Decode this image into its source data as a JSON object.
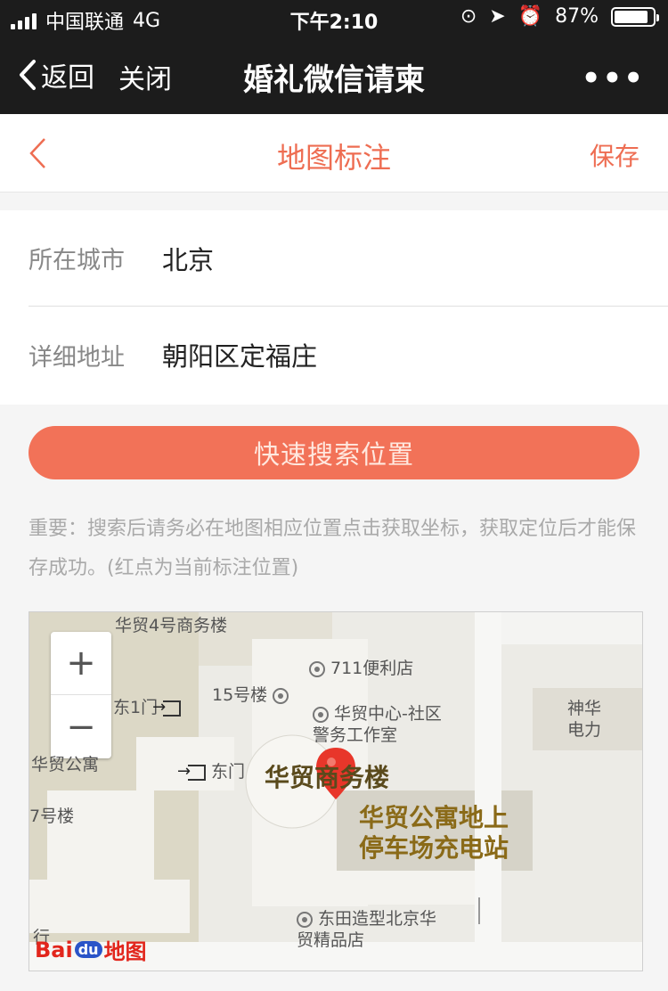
{
  "status_bar": {
    "carrier": "中国联通",
    "network": "4G",
    "time": "下午2:10",
    "battery_pct": 87,
    "battery_label": "87%"
  },
  "nav_bar": {
    "back_label": "返回",
    "close_label": "关闭",
    "title": "婚礼微信请柬",
    "more_label": "•••"
  },
  "header": {
    "title": "地图标注",
    "save_label": "保存"
  },
  "form": {
    "city_label": "所在城市",
    "city_value": "北京",
    "address_label": "详细地址",
    "address_value": "朝阳区定福庄"
  },
  "search_button_label": "快速搜索位置",
  "notice": "重要：搜索后请务必在地图相应位置点击获取坐标，获取定位后才能保存成功。(红点为当前标注位置)",
  "map": {
    "zoom_in": "+",
    "zoom_out": "−",
    "labels": {
      "building_4": "华贸4号商务楼",
      "shop_711": "711便利店",
      "east_gate_1": "东1门",
      "building_15": "15号楼",
      "community": "华贸中心-社区\n警务工作室",
      "shenhua": "神华\n电力",
      "apartment": "华贸公寓",
      "east_gate": "东门",
      "main_building": "华贸商务楼",
      "building_7": "7号楼",
      "callout": "华贸公寓地上\n停车场充电站",
      "dongtian": "东田造型北京华\n贸精品店",
      "row": "行"
    },
    "logo": {
      "bai": "Bai",
      "du": "du",
      "word": "地图"
    },
    "colors": {
      "marker": "#e8362a",
      "block": "#d6d3c8"
    }
  }
}
